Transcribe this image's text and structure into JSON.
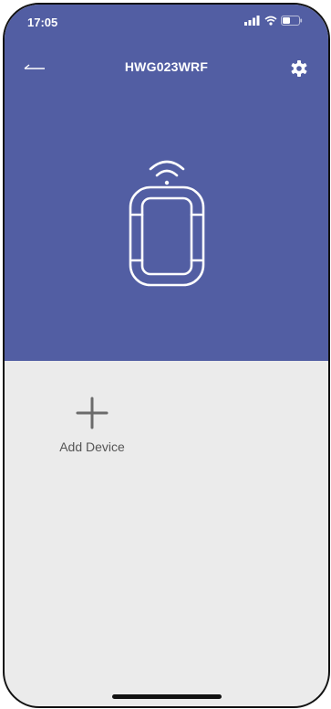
{
  "status_bar": {
    "time": "17:05",
    "icons": [
      "cellular-signal-icon",
      "wifi-icon",
      "battery-icon"
    ]
  },
  "nav": {
    "title": "HWG023WRF",
    "back_icon": "back-arrow-icon",
    "settings_icon": "gear-icon"
  },
  "hero": {
    "icon": "wireless-remote-device-icon"
  },
  "main": {
    "add_device_label": "Add Device",
    "add_icon": "plus-icon"
  },
  "colors": {
    "header_bg": "#525ea3",
    "content_bg": "#ebebeb",
    "text_on_header": "#ffffff",
    "label_text": "#555555"
  }
}
